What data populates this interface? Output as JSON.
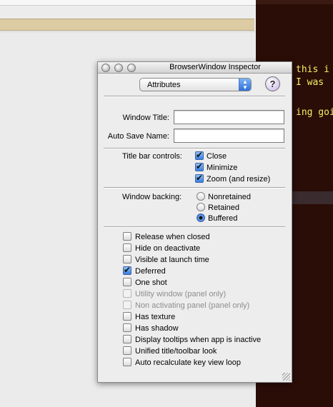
{
  "background": {
    "editor_lines": [
      {
        "text": "this i"
      },
      {
        "text": "I was "
      },
      {
        "text": "ing goi"
      }
    ],
    "editor_background": "#2a0d06",
    "editor_text_color": "#f6f060"
  },
  "inspector": {
    "title": "BrowserWindow Inspector",
    "popup": {
      "selected": "Attributes"
    },
    "help_label": "?",
    "window_title_label": "Window Title:",
    "window_title_value": "",
    "auto_save_label": "Auto Save Name:",
    "auto_save_value": "",
    "title_bar": {
      "label": "Title bar controls:",
      "options": [
        {
          "label": "Close",
          "checked": true
        },
        {
          "label": "Minimize",
          "checked": true
        },
        {
          "label": "Zoom (and resize)",
          "checked": true
        }
      ]
    },
    "backing": {
      "label": "Window backing:",
      "options": [
        {
          "label": "Nonretained",
          "selected": false
        },
        {
          "label": "Retained",
          "selected": false
        },
        {
          "label": "Buffered",
          "selected": true
        }
      ]
    },
    "options": [
      {
        "label": "Release when closed",
        "checked": false,
        "enabled": true
      },
      {
        "label": "Hide on deactivate",
        "checked": false,
        "enabled": true
      },
      {
        "label": "Visible at launch time",
        "checked": false,
        "enabled": true
      },
      {
        "label": "Deferred",
        "checked": true,
        "enabled": true
      },
      {
        "label": "One shot",
        "checked": false,
        "enabled": true
      },
      {
        "label": "Utility window (panel only)",
        "checked": false,
        "enabled": false
      },
      {
        "label": "Non activating panel (panel only)",
        "checked": false,
        "enabled": false
      },
      {
        "label": "Has texture",
        "checked": false,
        "enabled": true
      },
      {
        "label": "Has shadow",
        "checked": false,
        "enabled": true
      },
      {
        "label": "Display tooltips when app is inactive",
        "checked": false,
        "enabled": true
      },
      {
        "label": "Unified title/toolbar look",
        "checked": false,
        "enabled": true
      },
      {
        "label": "Auto recalculate key view loop",
        "checked": false,
        "enabled": true
      }
    ]
  }
}
